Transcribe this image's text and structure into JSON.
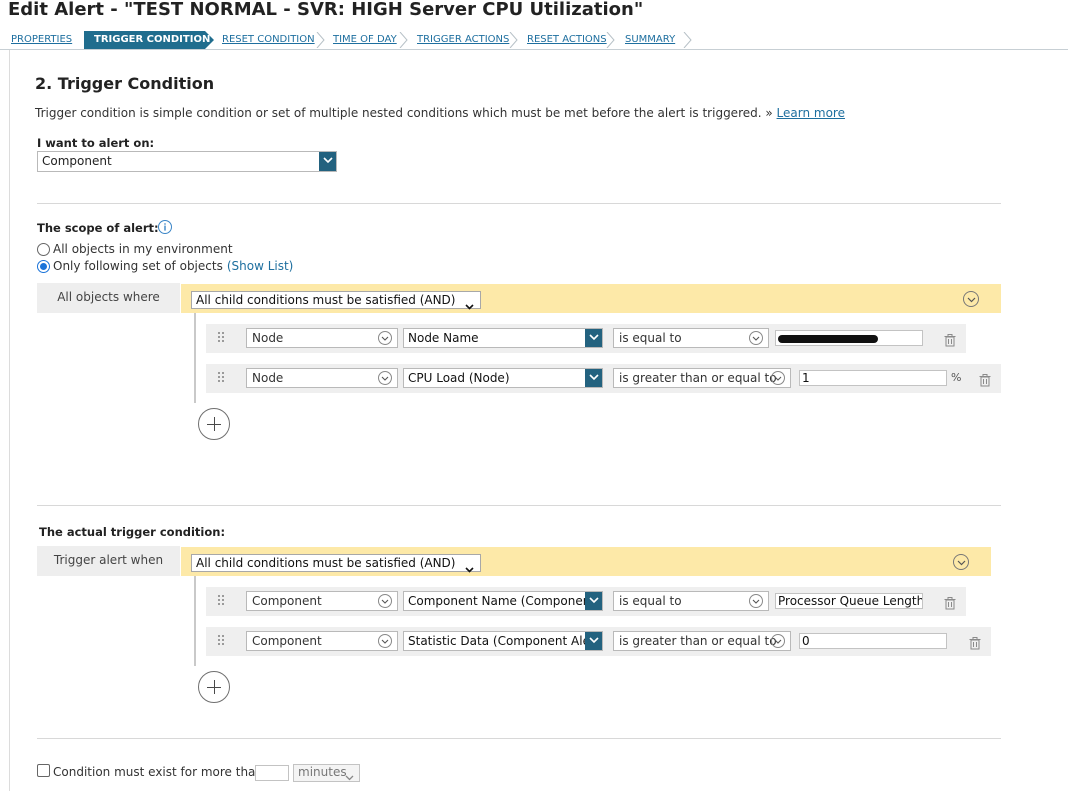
{
  "window": {
    "title": "Edit Alert - \"TEST NORMAL - SVR: HIGH Server CPU Utilization\""
  },
  "wizard": {
    "steps": [
      {
        "label": "PROPERTIES"
      },
      {
        "label": "TRIGGER CONDITION",
        "active": true
      },
      {
        "label": "RESET CONDITION"
      },
      {
        "label": "TIME OF DAY"
      },
      {
        "label": "TRIGGER ACTIONS"
      },
      {
        "label": "RESET ACTIONS"
      },
      {
        "label": "SUMMARY"
      }
    ]
  },
  "section": {
    "heading": "2. Trigger Condition",
    "description": "Trigger condition is simple condition or set of multiple nested conditions which must be met before the alert is triggered. »",
    "learn_more": "Learn more"
  },
  "alert_on": {
    "label": "I want to alert on:",
    "value": "Component"
  },
  "scope": {
    "label": "The scope of alert:",
    "option_all": "All objects in my environment",
    "option_following": "Only following set of objects",
    "show_list": "(Show List)",
    "selected": "following",
    "group_label": "All objects where",
    "group_operator": "All child conditions must be satisfied (AND)",
    "conditions": [
      {
        "object": "Node",
        "field": "Node Name",
        "operator": "is equal to",
        "value": "",
        "unit": ""
      },
      {
        "object": "Node",
        "field": "CPU Load (Node)",
        "operator": "is greater than or equal to",
        "value": "1",
        "unit": "%"
      }
    ]
  },
  "trigger": {
    "label": "The actual trigger condition:",
    "group_label": "Trigger alert when",
    "group_operator": "All child conditions must be satisfied (AND)",
    "conditions": [
      {
        "object": "Component",
        "field": "Component Name (Component A",
        "operator": "is equal to",
        "value": "Processor Queue Length"
      },
      {
        "object": "Component",
        "field": "Statistic Data (Component Alertin",
        "operator": "is greater than or equal to",
        "value": "0"
      }
    ]
  },
  "duration": {
    "label": "Condition must exist for more than",
    "value": "",
    "unit": "minutes"
  },
  "colors": {
    "accent": "#206d8e",
    "link": "#1e6f9f",
    "group_bar": "#fde9a8",
    "row_bg": "#efefef",
    "radio_selected": "#1a73d9"
  }
}
